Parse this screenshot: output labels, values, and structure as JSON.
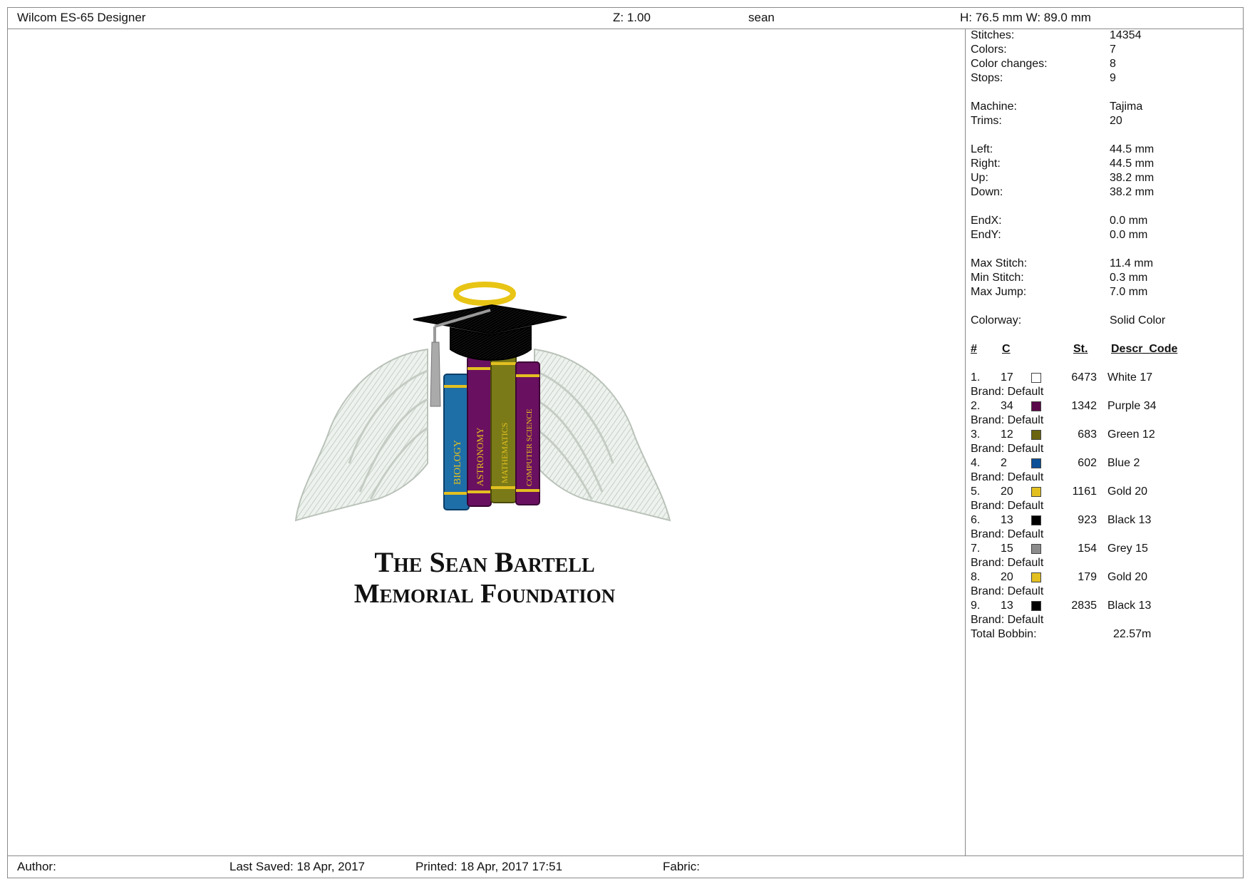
{
  "header": {
    "app_title": "Wilcom ES-65 Designer",
    "zoom": "Z: 1.00",
    "design_name": "sean",
    "size": "H: 76.5 mm   W: 89.0 mm"
  },
  "stats": [
    {
      "label": "Stitches:",
      "value": "14354"
    },
    {
      "label": "Colors:",
      "value": "7"
    },
    {
      "label": "Color changes:",
      "value": "8"
    },
    {
      "label": "Stops:",
      "value": "9"
    },
    {
      "label": "Machine:",
      "value": "Tajima"
    },
    {
      "label": "Trims:",
      "value": "20"
    },
    {
      "label": "Left:",
      "value": "44.5 mm"
    },
    {
      "label": "Right:",
      "value": "44.5 mm"
    },
    {
      "label": "Up:",
      "value": "38.2 mm"
    },
    {
      "label": "Down:",
      "value": "38.2 mm"
    },
    {
      "label": "EndX:",
      "value": "0.0 mm"
    },
    {
      "label": "EndY:",
      "value": "0.0 mm"
    },
    {
      "label": "Max Stitch:",
      "value": "11.4 mm"
    },
    {
      "label": "Min Stitch:",
      "value": "0.3 mm"
    },
    {
      "label": "Max Jump:",
      "value": "7.0 mm"
    },
    {
      "label": "Colorway:",
      "value": "Solid Color"
    }
  ],
  "table_headers": {
    "num": "#",
    "color": "C",
    "stitches": "St.",
    "descr": "Descr_Code"
  },
  "colors": [
    {
      "num": "1.",
      "code": "17",
      "swatch": "#ffffff",
      "stitches": "6473",
      "descr": "White 17",
      "brand": "Brand: Default"
    },
    {
      "num": "2.",
      "code": "34",
      "swatch": "#5a0a4a",
      "stitches": "1342",
      "descr": "Purple 34",
      "brand": "Brand: Default"
    },
    {
      "num": "3.",
      "code": "12",
      "swatch": "#6a6410",
      "stitches": "683",
      "descr": "Green 12",
      "brand": "Brand: Default"
    },
    {
      "num": "4.",
      "code": "2",
      "swatch": "#0c4f96",
      "stitches": "602",
      "descr": "Blue 2",
      "brand": "Brand: Default"
    },
    {
      "num": "5.",
      "code": "20",
      "swatch": "#e3c020",
      "stitches": "1161",
      "descr": "Gold 20",
      "brand": "Brand: Default"
    },
    {
      "num": "6.",
      "code": "13",
      "swatch": "#000000",
      "stitches": "923",
      "descr": "Black 13",
      "brand": "Brand: Default"
    },
    {
      "num": "7.",
      "code": "15",
      "swatch": "#8c8c8c",
      "stitches": "154",
      "descr": "Grey 15",
      "brand": "Brand: Default"
    },
    {
      "num": "8.",
      "code": "20",
      "swatch": "#e3c020",
      "stitches": "179",
      "descr": "Gold 20",
      "brand": "Brand: Default"
    },
    {
      "num": "9.",
      "code": "13",
      "swatch": "#000000",
      "stitches": "2835",
      "descr": "Black 13",
      "brand": "Brand: Default"
    }
  ],
  "total_bobbin": {
    "label": "Total Bobbin:",
    "value": "22.57m"
  },
  "design": {
    "line1": "The Sean Bartell",
    "line2": "Memorial Foundation",
    "books": [
      "BIOLOGY",
      "ASTRONOMY",
      "MATHEMATICS",
      "COMPUTER SCIENCE"
    ]
  },
  "footer": {
    "author": "Author:",
    "last_saved": "Last Saved: 18 Apr, 2017",
    "printed": "Printed: 18 Apr, 2017 17:51",
    "fabric": "Fabric:"
  }
}
